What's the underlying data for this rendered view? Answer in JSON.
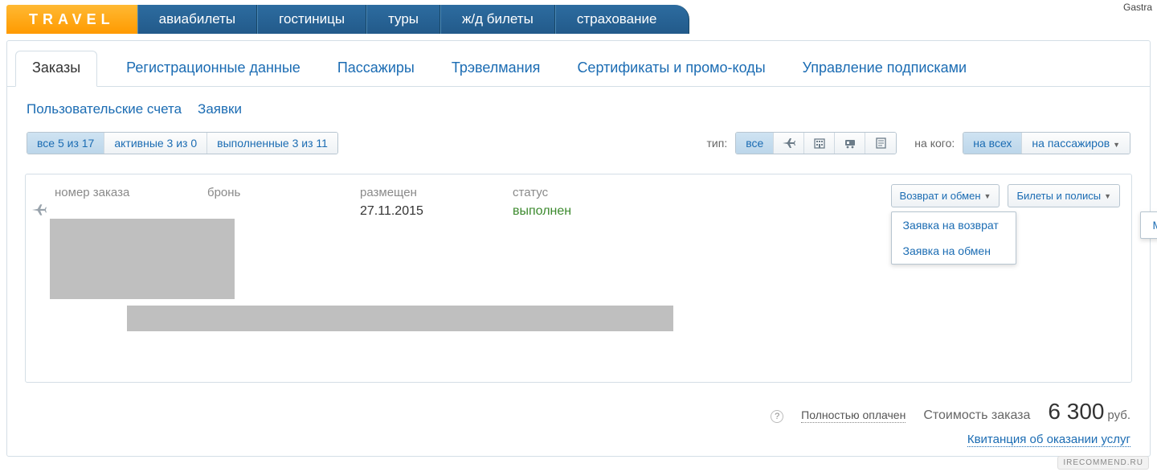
{
  "corner": "Gastra",
  "logo": "TRAVEL",
  "nav": [
    "авиабилеты",
    "гостиницы",
    "туры",
    "ж/д билеты",
    "страхование"
  ],
  "tabs": [
    "Заказы",
    "Регистрационные данные",
    "Пассажиры",
    "Трэвелмания",
    "Сертификаты и промо-коды",
    "Управление подписками"
  ],
  "sublinks": [
    "Пользовательские счета",
    "Заявки"
  ],
  "filters": {
    "all": "все 5 из 17",
    "active": "активные 3 из 0",
    "done": "выполненные 3 из 11",
    "type_label": "тип:",
    "type_all": "все",
    "whom_label": "на кого:",
    "whom_all": "на всех",
    "whom_pax": "на пассажиров"
  },
  "order": {
    "headers": {
      "num": "номер заказа",
      "booking": "бронь",
      "placed": "размещен",
      "status": "статус"
    },
    "placed": "27.11.2015",
    "status": "выполнен",
    "dd1": "Возврат и обмен",
    "dd2": "Билеты и полисы",
    "dd1_items": [
      "Заявка на возврат",
      "Заявка на обмен"
    ],
    "dd2_items": [
      "Маршрутная квитанция"
    ]
  },
  "payment": {
    "help": "?",
    "paid": "Полностью оплачен",
    "label": "Стоимость заказа",
    "amount": "6 300",
    "currency": "руб.",
    "receipt": "Квитанция об оказании услуг"
  },
  "watermark": "IRECOMMEND.RU"
}
